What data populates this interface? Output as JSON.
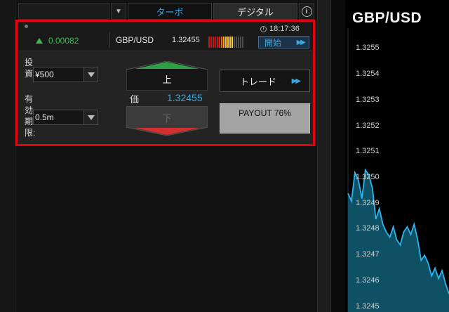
{
  "tabs": {
    "turbo": "ターボ",
    "digital": "デジタル",
    "info_icon": "info-icon"
  },
  "trade": {
    "change": "0.00082",
    "change_direction": "up",
    "pair": "GBP/USD",
    "rate": "1.32455",
    "time": "18:17:36",
    "start_label": "開始",
    "investment_label": "投資:",
    "investment_value": "¥500",
    "expiry_label": "有効期限:",
    "expiry_value": "0.5m",
    "up_label": "上",
    "down_label": "下",
    "price_label": "価",
    "price_value": "1.32455",
    "trade_label": "トレード",
    "payout_label": "PAYOUT 76%",
    "signal_colors": [
      "#b71c1c",
      "#b71c1c",
      "#b71c1c",
      "#b71c1c",
      "#b71c1c",
      "#c62828",
      "#ef6c00",
      "#f9a825",
      "#fbc02d",
      "#fbc02d",
      "#fbc02d",
      "#fdd835",
      "#4a4a4a",
      "#4a4a4a",
      "#4a4a4a",
      "#4a4a4a",
      "#4a4a4a"
    ]
  },
  "colors": {
    "accent": "#36a9e1",
    "up": "#3fb950",
    "down": "#e53935",
    "highlight": "#e3000f"
  },
  "chart_data": {
    "type": "area",
    "title": "GBP/USD",
    "ylim": [
      1.32448,
      1.32558
    ],
    "yticks": [
      "1.3255",
      "1.3254",
      "1.3253",
      "1.3252",
      "1.3251",
      "1.3250",
      "1.3249",
      "1.3248",
      "1.3247",
      "1.3246",
      "1.3245"
    ],
    "series": [
      {
        "values": [
          1.32494,
          1.32491,
          1.32502,
          1.32499,
          1.32492,
          1.32503,
          1.32501,
          1.32496,
          1.32484,
          1.32488,
          1.32482,
          1.32479,
          1.32477,
          1.32481,
          1.32476,
          1.32474,
          1.32479,
          1.32481,
          1.32478,
          1.32482,
          1.32476,
          1.32468,
          1.3247,
          1.32467,
          1.32462,
          1.32465,
          1.32461,
          1.32464,
          1.32459,
          1.32455
        ]
      }
    ]
  }
}
